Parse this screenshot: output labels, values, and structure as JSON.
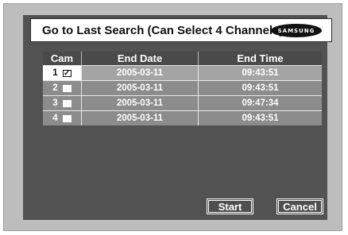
{
  "title": "Go to Last Search (Can Select 4 Channels)",
  "logo_text": "SAMSUNG",
  "columns": [
    "Cam",
    "End Date",
    "End Time"
  ],
  "rows": [
    {
      "cam": "1",
      "checked": true,
      "check_glyph": "✓",
      "end_date": "2005-03-11",
      "end_time": "09:43:51"
    },
    {
      "cam": "2",
      "checked": false,
      "check_glyph": "",
      "end_date": "2005-03-11",
      "end_time": "09:43:51"
    },
    {
      "cam": "3",
      "checked": false,
      "check_glyph": "",
      "end_date": "2005-03-11",
      "end_time": "09:47:34"
    },
    {
      "cam": "4",
      "checked": false,
      "check_glyph": "",
      "end_date": "2005-03-11",
      "end_time": "09:43:51"
    }
  ],
  "buttons": {
    "start": "Start",
    "cancel": "Cancel"
  },
  "colors": {
    "panel": "#525252",
    "frame": "#bdbdbd",
    "row": "#8c8c8c",
    "selected_row": "#a4a4a4"
  }
}
